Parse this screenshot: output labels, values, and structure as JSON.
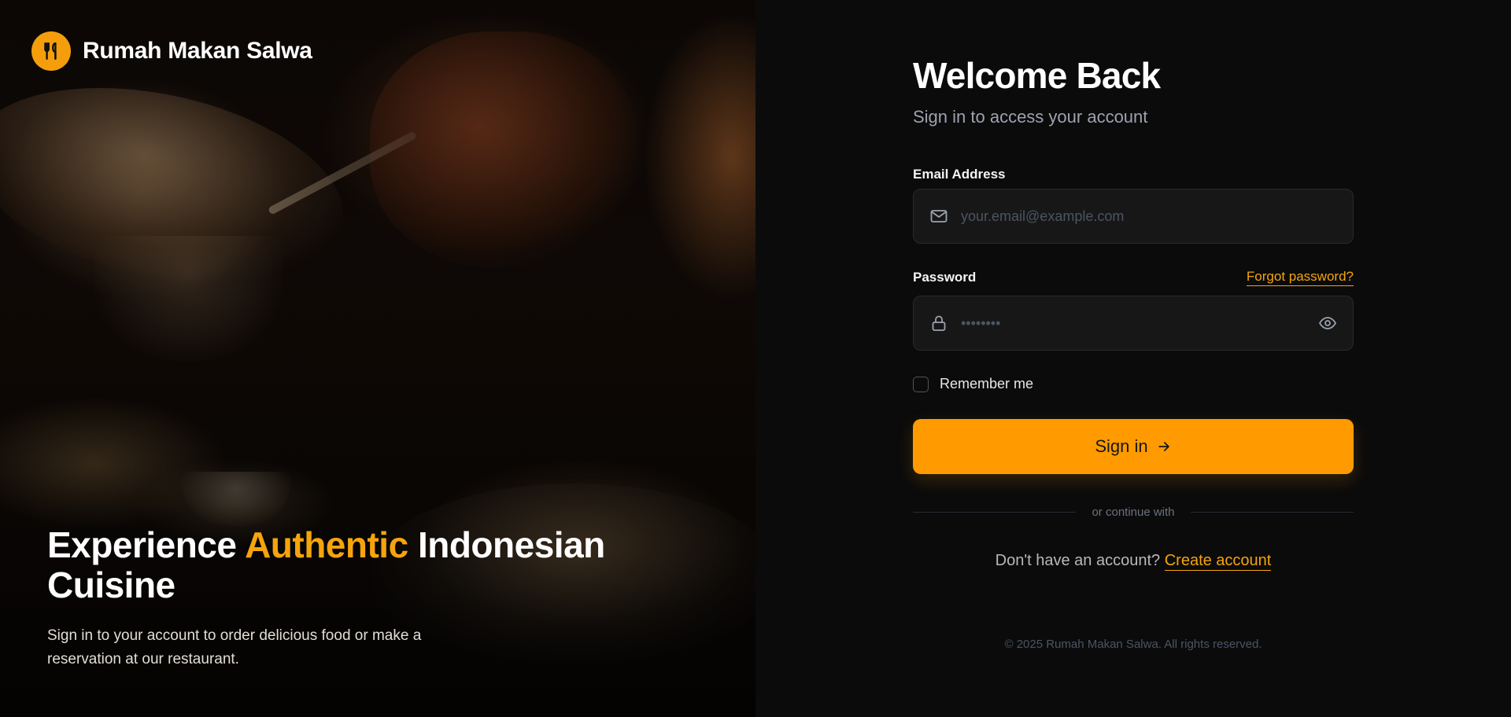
{
  "brand": {
    "name": "Rumah Makan Salwa",
    "logo_icon": "fork-knife-icon",
    "accent_color": "#f59e0b"
  },
  "hero": {
    "title_part1": "Experience ",
    "title_accent": "Authentic",
    "title_part2": " Indonesian Cuisine",
    "subtitle": "Sign in to your account to order delicious food or make a reservation at our restaurant."
  },
  "form": {
    "title": "Welcome Back",
    "subtitle": "Sign in to access your account",
    "email": {
      "label": "Email Address",
      "placeholder": "your.email@example.com",
      "value": "",
      "icon": "mail-icon"
    },
    "password": {
      "label": "Password",
      "forgot_label": "Forgot password?",
      "placeholder": "••••••••",
      "value": "",
      "icon": "lock-icon",
      "toggle_icon": "eye-icon"
    },
    "remember_label": "Remember me",
    "remember_checked": false,
    "submit_label": "Sign in",
    "submit_icon": "arrow-right-icon",
    "divider_text": "or continue with",
    "signup_prompt": "Don't have an account?",
    "signup_link": "Create account",
    "button_color": "#ff9a00"
  },
  "footer": {
    "copyright": "© 2025 Rumah Makan Salwa. All rights reserved."
  }
}
